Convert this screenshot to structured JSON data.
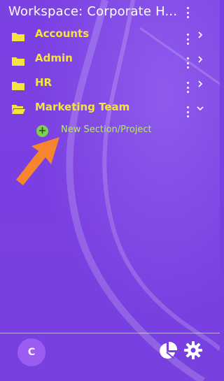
{
  "workspace": {
    "title": "Workspace: Corporate H..."
  },
  "folders": [
    {
      "label": "Accounts",
      "open": false
    },
    {
      "label": "Admin",
      "open": false
    },
    {
      "label": "HR",
      "open": false
    },
    {
      "label": "Marketing Team",
      "open": true
    }
  ],
  "new_item": {
    "label": "New Section/Project"
  },
  "user": {
    "initial": "C"
  },
  "colors": {
    "background": "#7a3fe0",
    "folder_label": "#f5e340",
    "new_item_label": "#b6e86a",
    "plus_icon": "#7ccd53",
    "annotation_arrow": "#f7852d"
  },
  "icons": [
    "kebab-menu-icon",
    "folder-icon",
    "folder-open-icon",
    "chevron-right-icon",
    "chevron-down-icon",
    "plus-circle-icon",
    "pie-chart-icon",
    "gear-icon",
    "annotation-arrow"
  ]
}
